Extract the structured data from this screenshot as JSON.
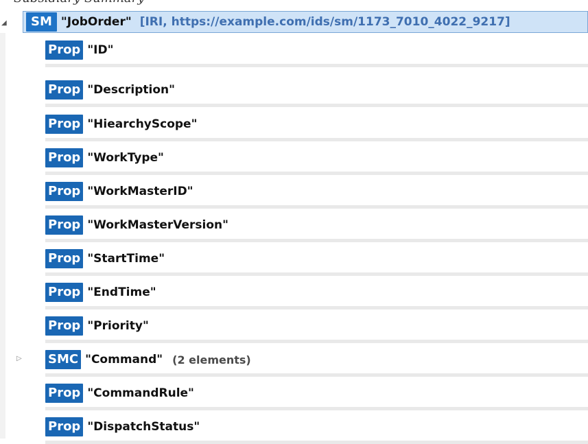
{
  "header_clip": "Subsidiary Summary",
  "root": {
    "badge": "SM",
    "name": "\"JobOrder\"",
    "info": "[IRI, https://example.com/ids/sm/1173_7010_4022_9217]"
  },
  "items": [
    {
      "badge": "Prop",
      "name": "\"ID\""
    },
    {
      "badge": "Prop",
      "name": "\"Description\""
    },
    {
      "badge": "Prop",
      "name": "\"HiearchyScope\""
    },
    {
      "badge": "Prop",
      "name": "\"WorkType\""
    },
    {
      "badge": "Prop",
      "name": "\"WorkMasterID\""
    },
    {
      "badge": "Prop",
      "name": "\"WorkMasterVersion\""
    },
    {
      "badge": "Prop",
      "name": "\"StartTime\""
    },
    {
      "badge": "Prop",
      "name": "\"EndTime\""
    },
    {
      "badge": "Prop",
      "name": "\"Priority\""
    },
    {
      "badge": "SMC",
      "name": "\"Command\"",
      "count": "(2 elements)"
    },
    {
      "badge": "Prop",
      "name": "\"CommandRule\""
    },
    {
      "badge": "Prop",
      "name": "\"DispatchStatus\""
    }
  ]
}
